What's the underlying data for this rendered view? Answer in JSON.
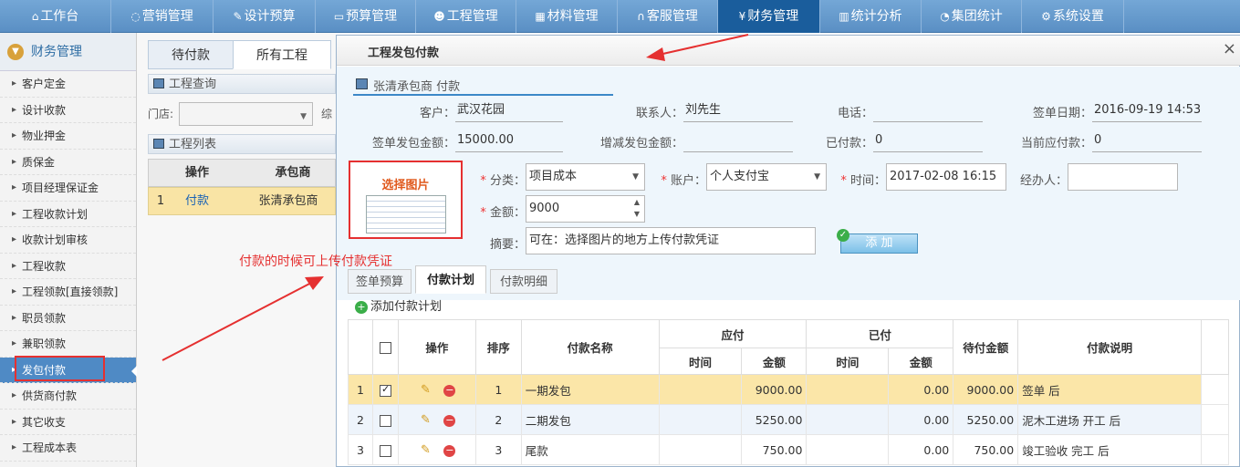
{
  "nav": {
    "items": [
      {
        "label": "工作台",
        "icon": "home-icon"
      },
      {
        "label": "营销管理",
        "icon": "chat-icon"
      },
      {
        "label": "设计预算",
        "icon": "edit-icon"
      },
      {
        "label": "预算管理",
        "icon": "monitor-icon"
      },
      {
        "label": "工程管理",
        "icon": "users-icon"
      },
      {
        "label": "材料管理",
        "icon": "grid-icon"
      },
      {
        "label": "客服管理",
        "icon": "headset-icon"
      },
      {
        "label": "财务管理",
        "icon": "yen-icon"
      },
      {
        "label": "统计分析",
        "icon": "chart-icon"
      },
      {
        "label": "集团统计",
        "icon": "pie-icon"
      },
      {
        "label": "系统设置",
        "icon": "gear-icon"
      }
    ],
    "active": "财务管理"
  },
  "sidebar": {
    "title": "财务管理",
    "items": [
      "客户定金",
      "设计收款",
      "物业押金",
      "质保金",
      "项目经理保证金",
      "工程收款计划",
      "收款计划审核",
      "工程收款",
      "工程领款[直接领款]",
      "职员领款",
      "兼职领款",
      "发包付款",
      "供货商付款",
      "其它收支",
      "工程成本表"
    ],
    "active": "发包付款"
  },
  "midpanel": {
    "tabs": [
      "待付款",
      "所有工程"
    ],
    "query_title": "工程查询",
    "store_label": "门店:",
    "store_suffix": "综",
    "list_title": "工程列表",
    "list_headers": [
      "操作",
      "承包商"
    ],
    "list_rows": [
      {
        "num": "1",
        "action": "付款",
        "contractor": "张清承包商"
      }
    ]
  },
  "modal": {
    "title": "工程发包付款",
    "close": "×",
    "section_title": "张清承包商 付款",
    "info": {
      "customer_label": "客户：",
      "customer": "武汉花园",
      "contact_label": "联系人：",
      "contact": "刘先生",
      "phone_label": "电话：",
      "phone": "",
      "signdate_label": "签单日期：",
      "signdate": "2016-09-19 14:53",
      "contract_label": "签单发包金额：",
      "contract": "15000.00",
      "adjust_label": "增减发包金额：",
      "adjust": "",
      "paid_label": "已付款：",
      "paid": "0",
      "due_label": "当前应付款：",
      "due": "0"
    },
    "image_upload": {
      "label": "选择图片"
    },
    "form": {
      "category_label": "分类：",
      "category": "项目成本",
      "account_label": "账户：",
      "account": "个人支付宝",
      "time_label": "时间：",
      "time": "2017-02-08 16:15",
      "handler_label": "经办人：",
      "handler": "",
      "amount_label": "金额：",
      "amount": "9000",
      "remark_label": "摘要：",
      "remark": "可在：选择图片的地方上传付款凭证",
      "add_button": "添 加"
    },
    "annotation": "付款的时候可上传付款凭证",
    "tabs": [
      "签单预算",
      "付款计划",
      "付款明细"
    ],
    "active_tab": "付款计划",
    "add_plan": "添加付款计划",
    "grid": {
      "headers": {
        "action": "操作",
        "order": "排序",
        "name": "付款名称",
        "payable": "应付",
        "paid": "已付",
        "time": "时间",
        "amount": "金额",
        "pending": "待付金额",
        "desc": "付款说明"
      },
      "rows": [
        {
          "num": "1",
          "checked": true,
          "order": "1",
          "name": "一期发包",
          "pay_time": "",
          "pay_amount": "9000.00",
          "paid_time": "",
          "paid_amount": "0.00",
          "pending": "9000.00",
          "desc": "签单 后"
        },
        {
          "num": "2",
          "checked": false,
          "order": "2",
          "name": "二期发包",
          "pay_time": "",
          "pay_amount": "5250.00",
          "paid_time": "",
          "paid_amount": "0.00",
          "pending": "5250.00",
          "desc": "泥木工进场 开工 后"
        },
        {
          "num": "3",
          "checked": false,
          "order": "3",
          "name": "尾款",
          "pay_time": "",
          "pay_amount": "750.00",
          "paid_time": "",
          "paid_amount": "0.00",
          "pending": "750.00",
          "desc": "竣工验收 完工 后"
        }
      ]
    }
  },
  "colors": {
    "nav_bg": "#5a8fc4",
    "nav_active": "#1a5d9c",
    "highlight_red": "#e53030",
    "selected_row": "#fbe6a8"
  }
}
